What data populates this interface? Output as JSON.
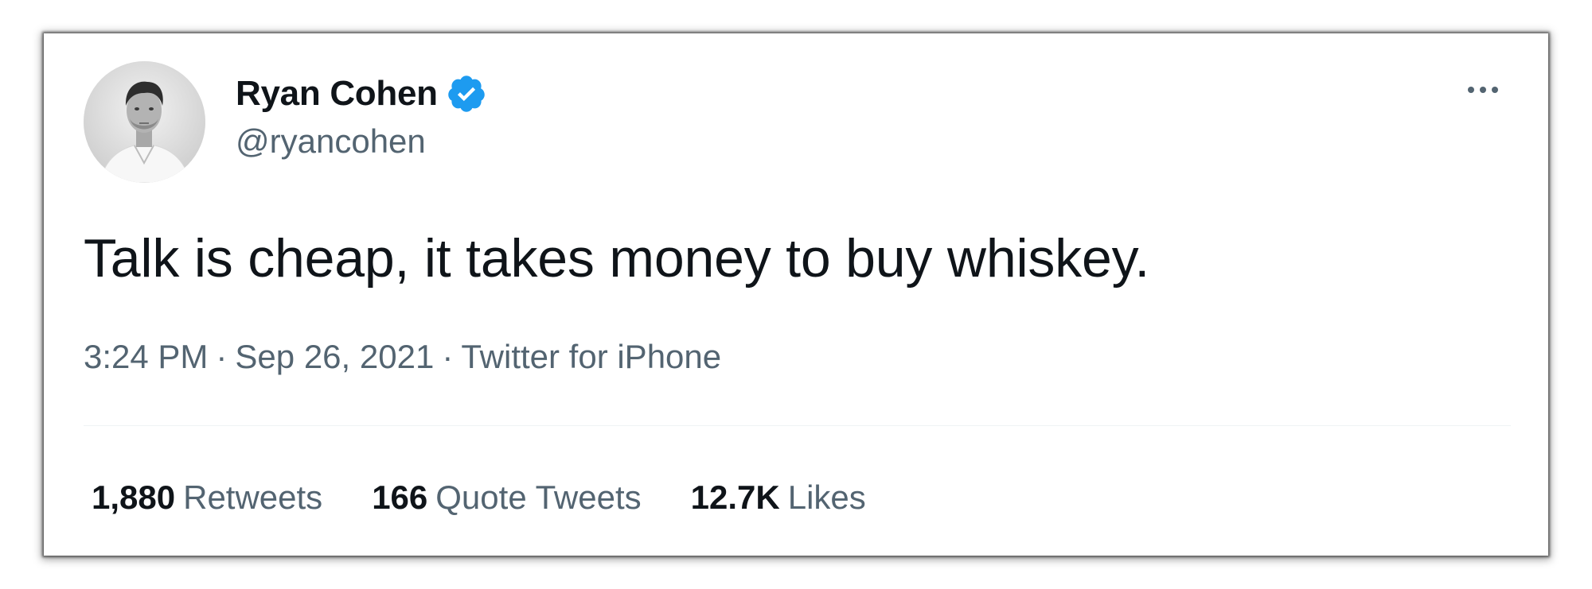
{
  "tweet": {
    "author": {
      "display_name": "Ryan Cohen",
      "handle": "@ryancohen",
      "verified": true,
      "avatar_icon": "profile-photo"
    },
    "text": "Talk is cheap, it takes money to buy whiskey.",
    "time": "3:24 PM",
    "date": "Sep 26, 2021",
    "source": "Twitter for iPhone",
    "separator": "·",
    "stats": [
      {
        "count": "1,880",
        "label": "Retweets"
      },
      {
        "count": "166",
        "label": "Quote Tweets"
      },
      {
        "count": "12.7K",
        "label": "Likes"
      }
    ]
  },
  "colors": {
    "text_primary": "#0f1419",
    "text_secondary": "#536471",
    "verified_blue": "#1d9bf0",
    "divider": "#eff3f4"
  }
}
